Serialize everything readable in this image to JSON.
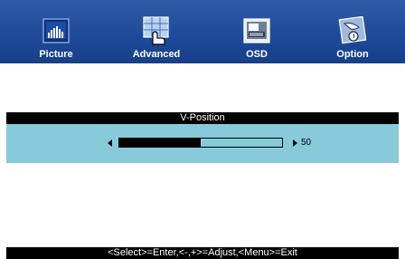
{
  "nav": {
    "tabs": [
      {
        "label": "Picture",
        "icon": "picture-icon",
        "selected": true
      },
      {
        "label": "Advanced",
        "icon": "advanced-icon",
        "selected": false
      },
      {
        "label": "OSD",
        "icon": "osd-icon",
        "selected": false
      },
      {
        "label": "Option",
        "icon": "option-icon",
        "selected": false
      }
    ]
  },
  "section": {
    "title": "V-Position"
  },
  "slider": {
    "value": "50",
    "fill_fraction": 0.5
  },
  "help": {
    "text": "<Select>=Enter,<-,+>=Adjust,<Menu>=Exit"
  },
  "colors": {
    "topbar": "#1d4a98",
    "slider_row": "#87cad9",
    "bar": "#000000",
    "text_light": "#ffffff"
  }
}
